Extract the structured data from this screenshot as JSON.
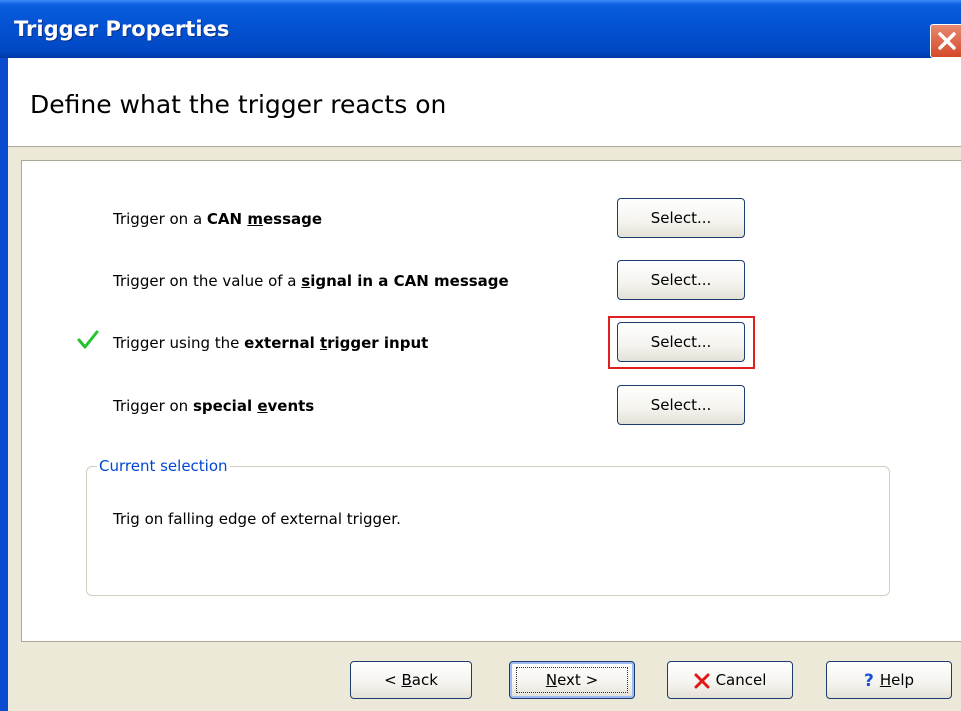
{
  "window": {
    "title": "Trigger Properties"
  },
  "header": {
    "text": "Define what the trigger reacts on"
  },
  "options": [
    {
      "prefix": "Trigger on a ",
      "bold_pre": "CAN ",
      "bold_ul": "m",
      "bold_post": "essage",
      "button": "Select..."
    },
    {
      "prefix": "Trigger on the value of a ",
      "bold_pre": "",
      "bold_ul": "s",
      "bold_post": "ignal in a CAN message",
      "button": "Select..."
    },
    {
      "prefix": "Trigger using the ",
      "bold_pre": "external ",
      "bold_ul": "t",
      "bold_post": "rigger input",
      "button": "Select..."
    },
    {
      "prefix": "Trigger on ",
      "bold_pre": "special ",
      "bold_ul": "e",
      "bold_post": "vents",
      "button": "Select..."
    }
  ],
  "selected_option_index": 2,
  "current_selection": {
    "legend": "Current selection",
    "text": "Trig on falling edge of external trigger."
  },
  "buttons": {
    "back_pre": "< ",
    "back_ul": "B",
    "back_post": "ack",
    "next_ul": "N",
    "next_post": "ext >",
    "cancel": "Cancel",
    "help_ul": "H",
    "help_post": "elp"
  },
  "colors": {
    "title_bar": "#0453d4",
    "check": "#22c32e",
    "highlight": "#e02020",
    "legend": "#0046d5"
  },
  "icons": {
    "close": "close-icon",
    "check": "checkmark-icon",
    "cancel": "red-x-icon",
    "help": "question-mark-icon"
  }
}
